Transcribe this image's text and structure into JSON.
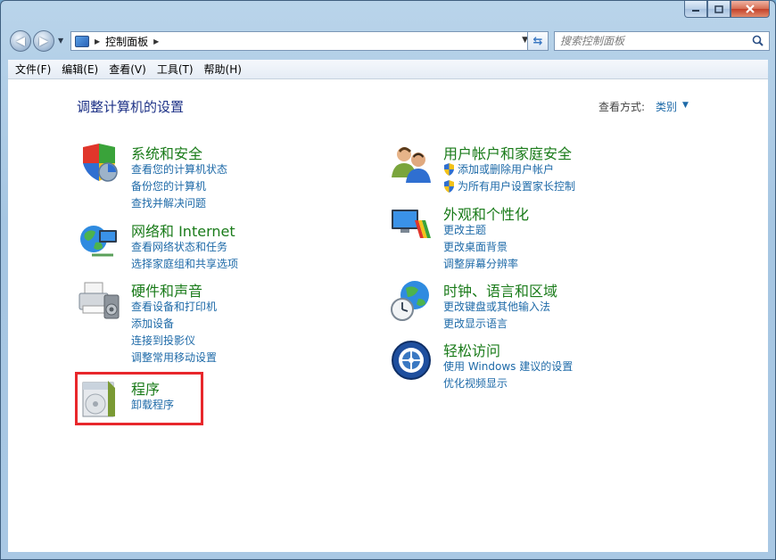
{
  "window": {
    "caption_buttons": [
      "minimize",
      "maximize",
      "close"
    ]
  },
  "navigation": {
    "breadcrumb": "控制面板",
    "search_placeholder": "搜索控制面板"
  },
  "menu": [
    "文件(F)",
    "编辑(E)",
    "查看(V)",
    "工具(T)",
    "帮助(H)"
  ],
  "main": {
    "heading": "调整计算机的设置",
    "view_by_label": "查看方式:",
    "view_by_value": "类别"
  },
  "categories": [
    {
      "title": "系统和安全",
      "icon": "shield-icon",
      "links": [
        "查看您的计算机状态",
        "备份您的计算机",
        "查找并解决问题"
      ]
    },
    {
      "title": "网络和 Internet",
      "icon": "network-icon",
      "links": [
        "查看网络状态和任务",
        "选择家庭组和共享选项"
      ]
    },
    {
      "title": "硬件和声音",
      "icon": "printer-icon",
      "links": [
        "查看设备和打印机",
        "添加设备",
        "连接到投影仪",
        "调整常用移动设置"
      ]
    },
    {
      "title": "程序",
      "icon": "programs-icon",
      "links": [
        "卸载程序"
      ]
    },
    {
      "title": "用户帐户和家庭安全",
      "icon": "users-icon",
      "links": [
        "添加或删除用户帐户",
        "为所有用户设置家长控制"
      ]
    },
    {
      "title": "外观和个性化",
      "icon": "appearance-icon",
      "links": [
        "更改主题",
        "更改桌面背景",
        "调整屏幕分辨率"
      ]
    },
    {
      "title": "时钟、语言和区域",
      "icon": "clock-globe-icon",
      "links": [
        "更改键盘或其他输入法",
        "更改显示语言"
      ]
    },
    {
      "title": "轻松访问",
      "icon": "ease-of-access-icon",
      "links": [
        "使用 Windows 建议的设置",
        "优化视频显示"
      ]
    }
  ],
  "colors": {
    "category_title": "#1a7b1a",
    "link": "#1e6aa8",
    "heading": "#1e3287",
    "highlight_box": "#e8272b"
  }
}
